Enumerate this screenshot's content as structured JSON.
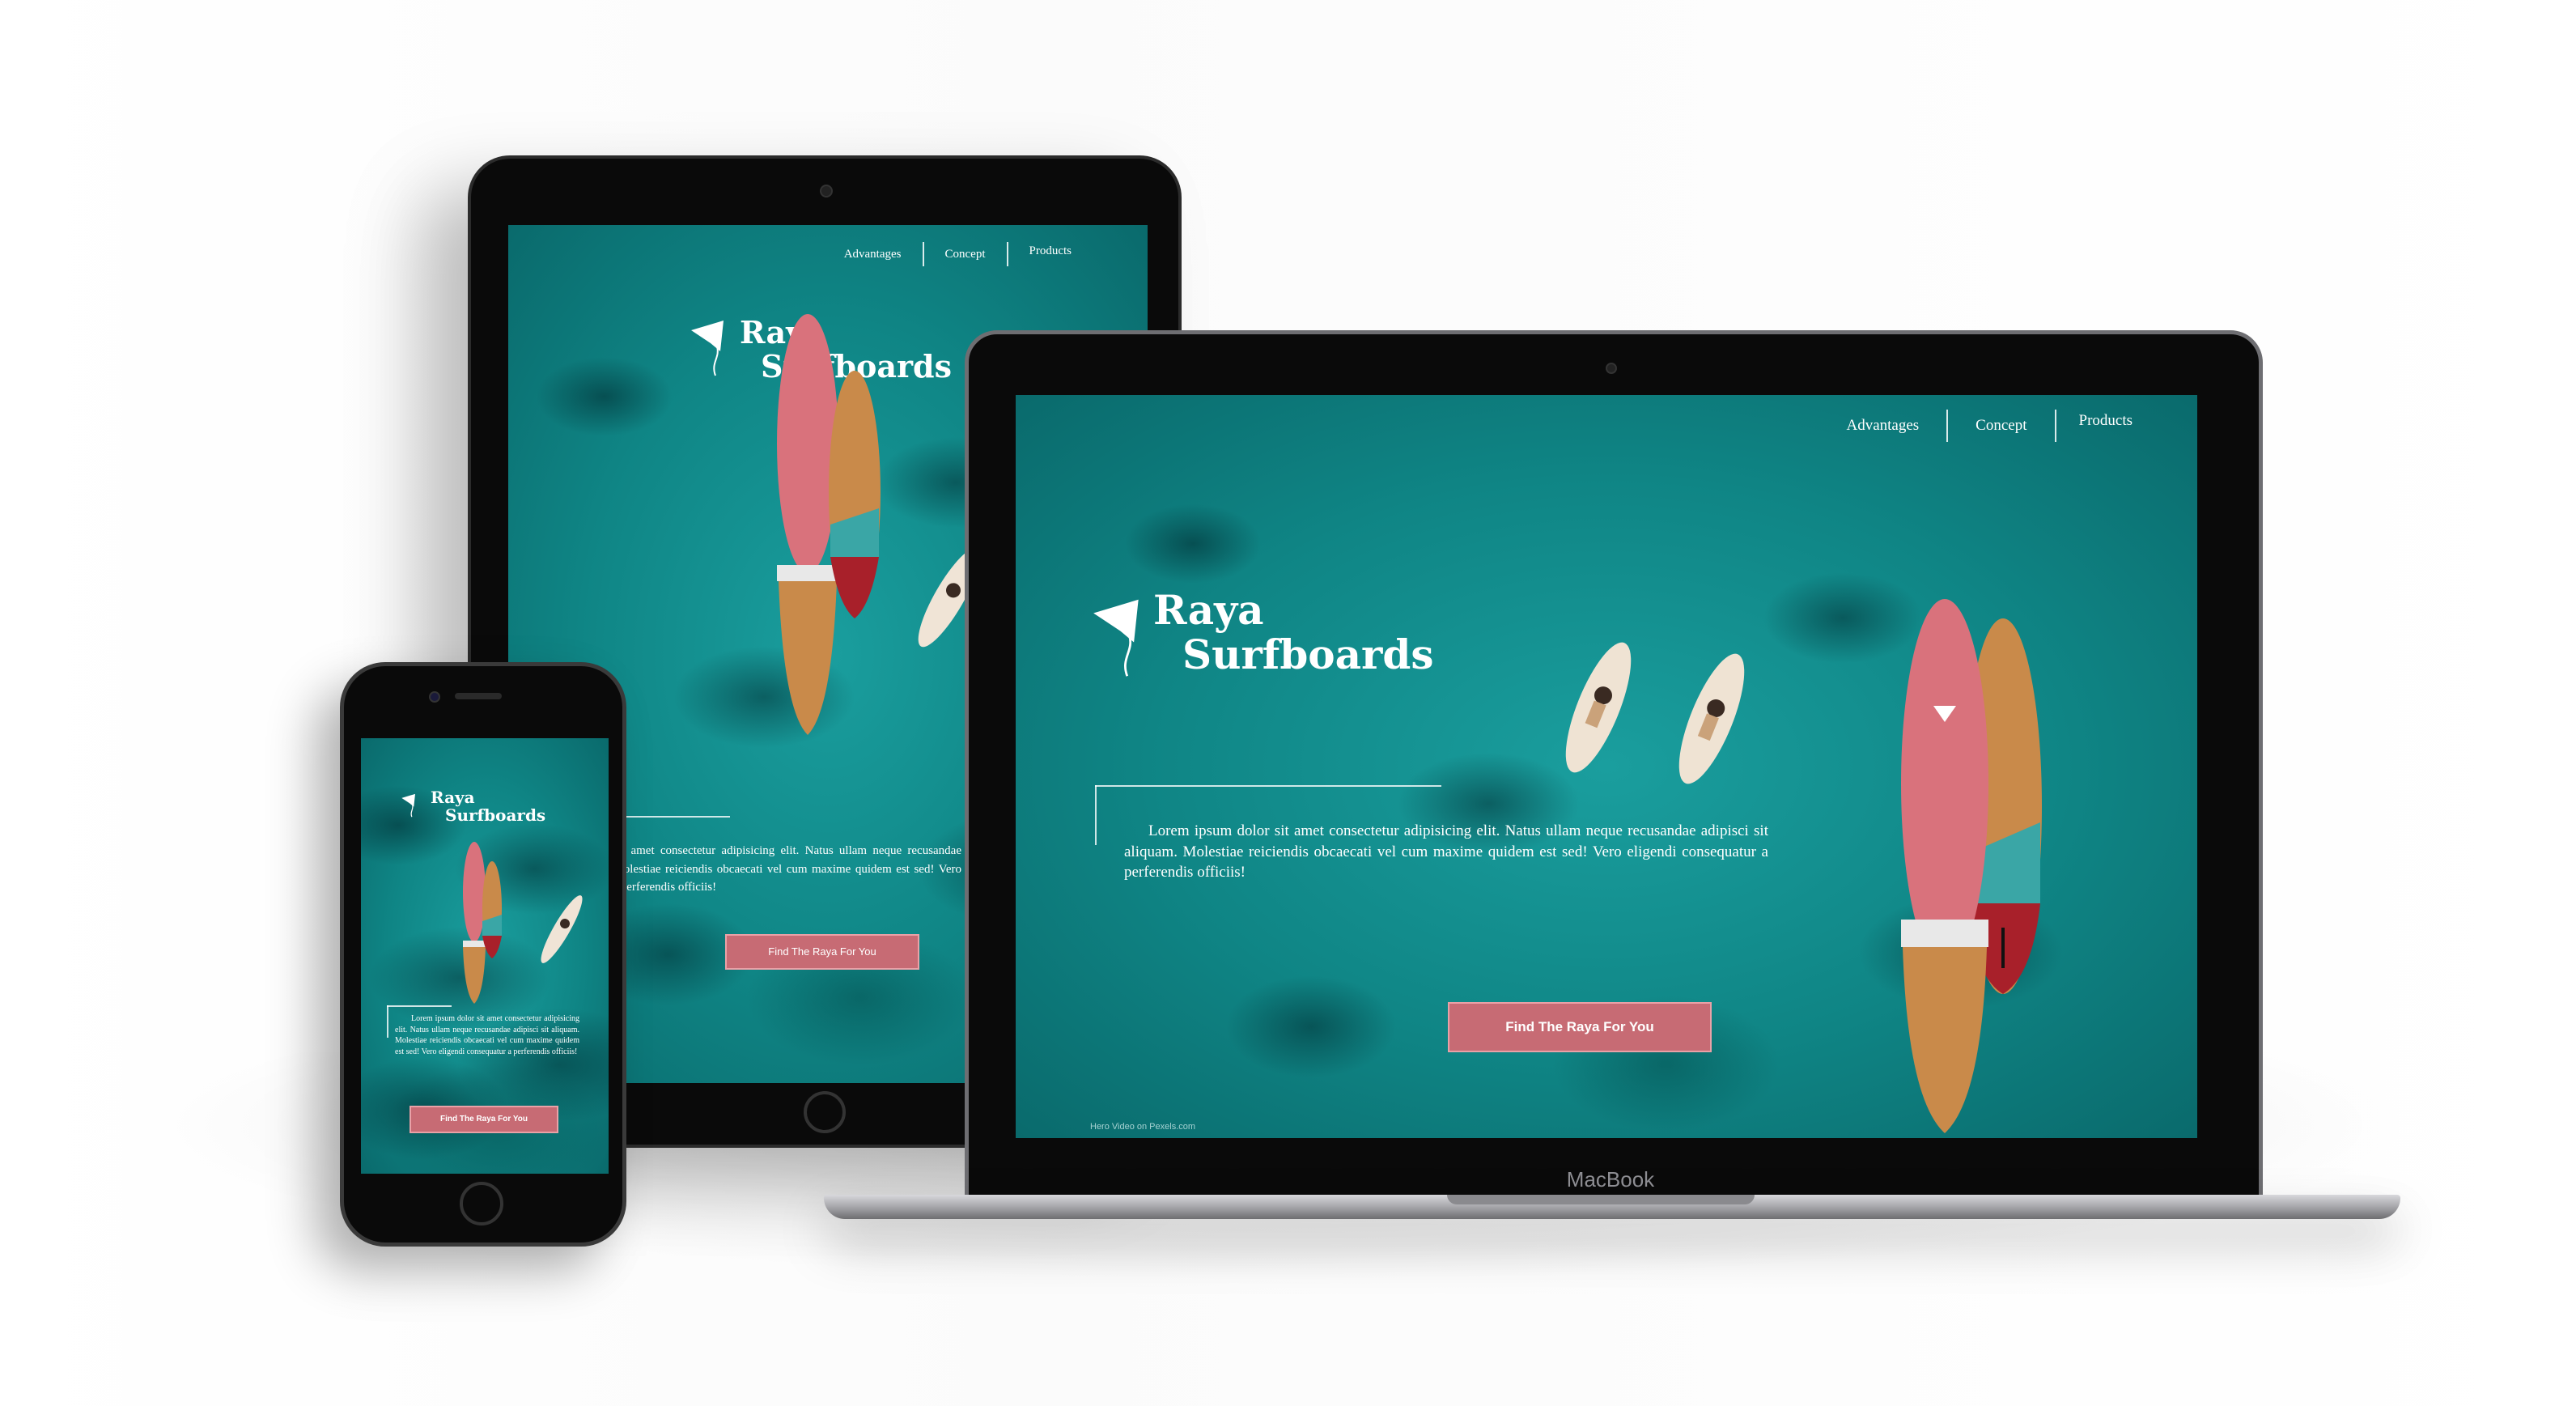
{
  "site": {
    "nav": [
      "Advantages",
      "Concept",
      "Products"
    ],
    "brand_line1": "Raya",
    "brand_line2": "Surfboards",
    "description": "Lorem ipsum dolor sit amet consectetur adipisicing elit. Natus ullam neque recusandae adipisci sit aliquam. Molestiae reiciendis obcaecati vel cum maxime quidem est sed! Vero eligendi consequatur a perferendis officiis!",
    "cta_label": "Find The Raya For You",
    "credit": "Hero Video on Pexels.com"
  },
  "laptop": {
    "brand_label": "MacBook"
  },
  "colors": {
    "ocean": "#0f8585",
    "cta": "#c76b74",
    "board_pink": "#d9727c",
    "board_wood": "#c98a4a",
    "board_teal": "#3aa6a6",
    "board_red": "#a8202a"
  }
}
